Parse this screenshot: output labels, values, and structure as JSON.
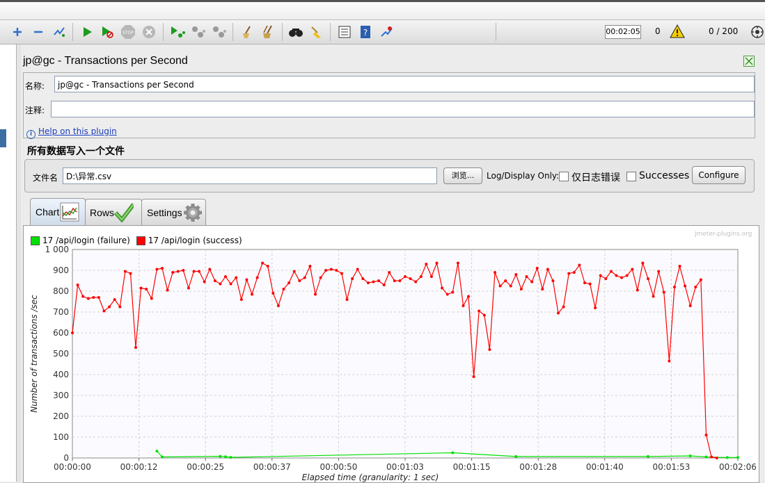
{
  "toolbar": {
    "timer": "00:02:05",
    "errors": "0",
    "threads": "0 / 200"
  },
  "panel": {
    "title": "jp@gc - Transactions per Second",
    "name_label": "名称:",
    "name_value": "jp@gc - Transactions per Second",
    "comment_label": "注释:",
    "comment_value": "",
    "help_link": "Help on this plugin"
  },
  "file_section": {
    "title": "所有数据写入一个文件",
    "filename_label": "文件名",
    "filename_value": "D:\\异常.csv",
    "browse_button": "浏览...",
    "log_display_label": "Log/Display Only:",
    "errors_only_label": "仅日志错误",
    "successes_label": "Successes",
    "configure_button": "Configure"
  },
  "tabs": [
    {
      "label": "Chart",
      "icon": "chart-icon",
      "active": true
    },
    {
      "label": "Rows",
      "icon": "checkmark-icon",
      "active": false
    },
    {
      "label": "Settings",
      "icon": "gear-icon",
      "active": false
    }
  ],
  "watermark": "jmeter-plugins.org",
  "colors": {
    "success": "#ff0000",
    "failure": "#00e000",
    "grid": "#d0d0d0"
  },
  "chart_data": {
    "type": "line",
    "xlabel": "Elapsed time (granularity: 1 sec)",
    "ylabel": "Number of transactions /sec",
    "ylim": [
      0,
      1000
    ],
    "xlim": [
      0,
      126
    ],
    "yticks": [
      "0",
      "100",
      "200",
      "300",
      "400",
      "500",
      "600",
      "700",
      "800",
      "900",
      "1 000"
    ],
    "xtick_labels": [
      "00:00:00",
      "00:00:12",
      "00:00:25",
      "00:00:37",
      "00:00:50",
      "00:01:03",
      "00:01:15",
      "00:01:28",
      "00:01:40",
      "00:01:53",
      "00:02:06"
    ],
    "legend": "top-left",
    "grid": true,
    "series": [
      {
        "name": "17 /api/login (failure)",
        "color": "#00e000",
        "x": [
          16,
          17,
          28,
          29,
          30,
          72,
          84,
          109,
          117,
          120,
          124,
          126
        ],
        "y": [
          33,
          5,
          8,
          6,
          3,
          25,
          7,
          7,
          10,
          5,
          2,
          2
        ]
      },
      {
        "name": "17 /api/login (success)",
        "color": "#ff0000",
        "y": [
          600,
          830,
          775,
          765,
          770,
          770,
          705,
          725,
          760,
          725,
          895,
          885,
          530,
          815,
          810,
          765,
          905,
          910,
          805,
          890,
          895,
          900,
          815,
          895,
          895,
          845,
          905,
          850,
          835,
          870,
          835,
          865,
          760,
          855,
          785,
          865,
          935,
          920,
          790,
          730,
          810,
          840,
          895,
          850,
          865,
          920,
          785,
          865,
          900,
          905,
          900,
          885,
          760,
          860,
          905,
          860,
          840,
          845,
          850,
          830,
          890,
          850,
          850,
          870,
          860,
          845,
          870,
          930,
          870,
          935,
          815,
          785,
          795,
          935,
          730,
          775,
          390,
          705,
          685,
          520,
          890,
          825,
          850,
          825,
          880,
          810,
          870,
          845,
          910,
          810,
          905,
          850,
          695,
          725,
          885,
          890,
          925,
          840,
          835,
          720,
          875,
          860,
          895,
          875,
          865,
          875,
          905,
          805,
          935,
          860,
          775,
          895,
          795,
          465,
          820,
          920,
          825,
          730,
          820,
          855,
          110,
          5,
          0
        ]
      }
    ]
  }
}
